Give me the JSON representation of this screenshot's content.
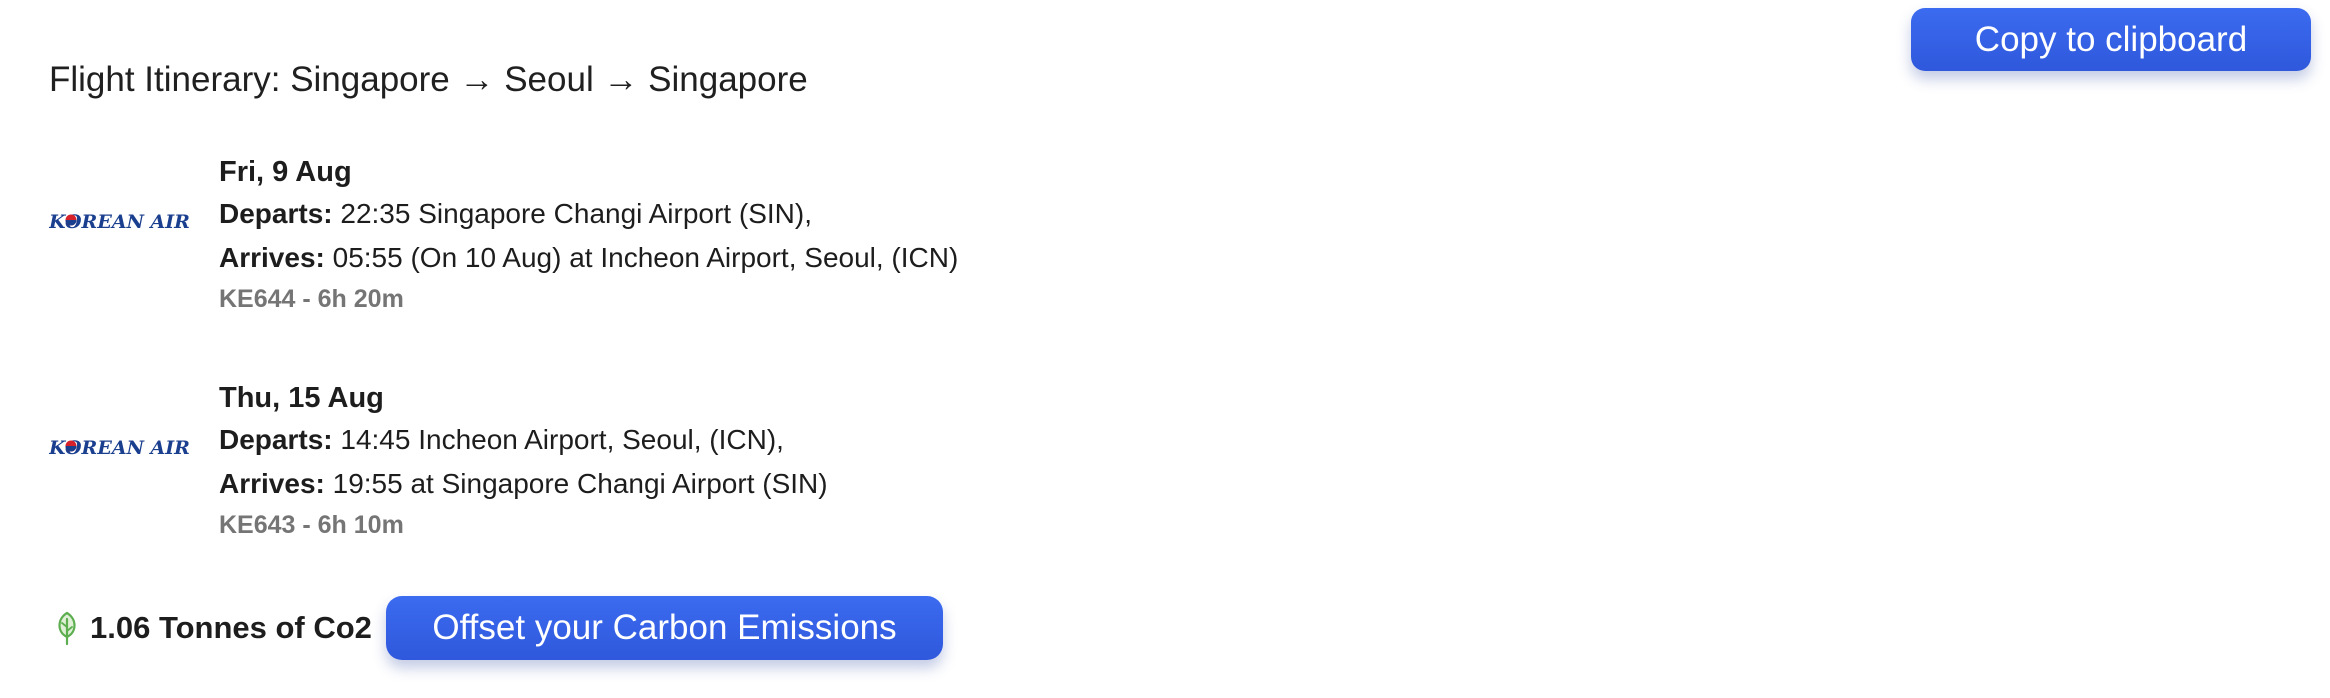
{
  "toolbar": {
    "copy_label": "Copy to clipboard"
  },
  "itinerary": {
    "title": "Flight Itinerary: Singapore → Seoul → Singapore",
    "flights": [
      {
        "airline": "KOREAN AIR",
        "date": "Fri, 9 Aug",
        "departs_label": "Departs:",
        "departs": " 22:35 Singapore Changi Airport (SIN),",
        "arrives_label": "Arrives:",
        "arrives": " 05:55 (On 10 Aug) at Incheon Airport, Seoul, (ICN)",
        "flight_info": "KE644 - 6h 20m"
      },
      {
        "airline": "KOREAN AIR",
        "date": "Thu, 15 Aug",
        "departs_label": "Departs:",
        "departs": " 14:45 Incheon Airport, Seoul, (ICN),",
        "arrives_label": "Arrives:",
        "arrives": " 19:55 at Singapore Changi Airport (SIN)",
        "flight_info": "KE643 - 6h 10m"
      }
    ]
  },
  "carbon": {
    "icon": "leaf-icon",
    "text": "1.06 Tonnes of Co2",
    "offset_label": "Offset your Carbon Emissions"
  },
  "colors": {
    "button_bg": "#3461e6",
    "button_text": "#ffffff",
    "airline_blue": "#1b3f8f",
    "airline_red": "#d6202a",
    "leaf_green": "#5cae4f",
    "muted_text": "#757575"
  }
}
